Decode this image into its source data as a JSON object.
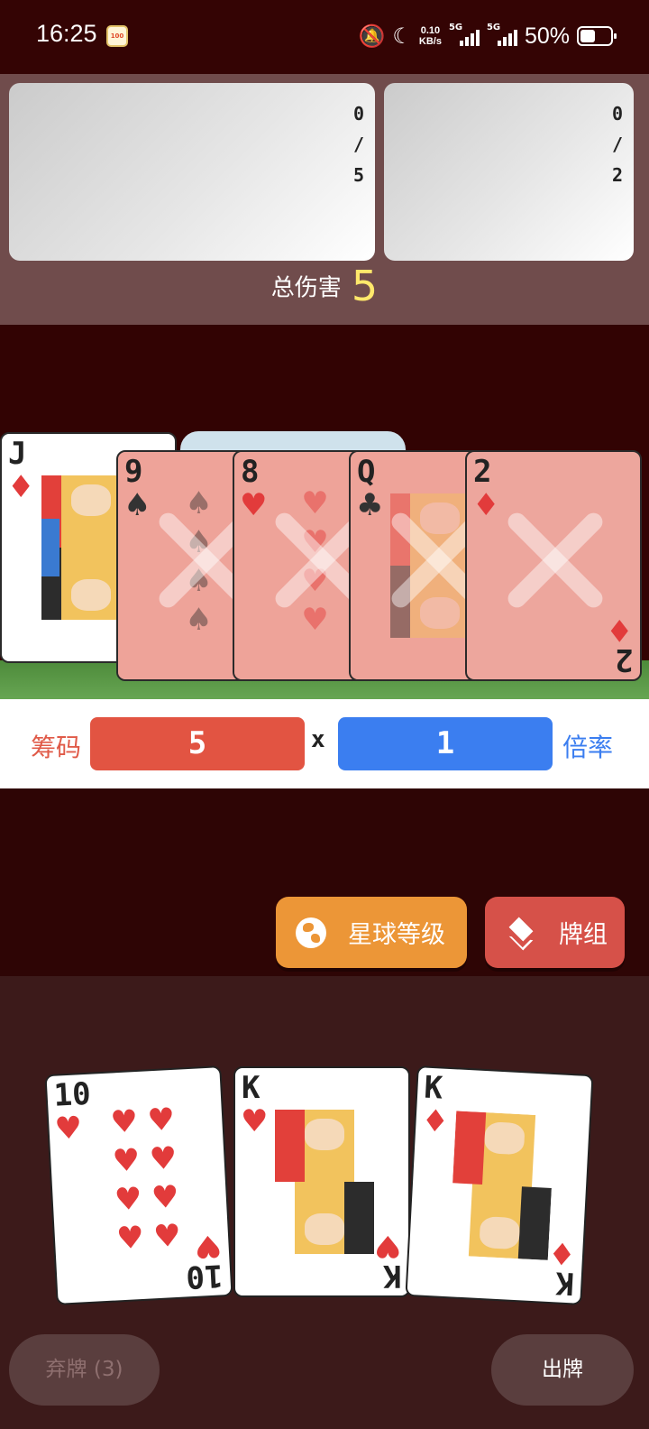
{
  "status_bar": {
    "time": "16:25",
    "app_badge": "100",
    "net_speed_value": "0.10",
    "net_speed_unit": "KB/s",
    "sim1_gen": "5G",
    "sim2_gen": "5G",
    "battery_percent": "50%",
    "battery_level": 0.5
  },
  "enemies": {
    "left": {
      "current": "0",
      "separator": "/",
      "max": "5"
    },
    "right": {
      "current": "0",
      "separator": "/",
      "max": "2"
    }
  },
  "total_damage": {
    "label": "总伤害",
    "value": "5"
  },
  "played_cards": [
    {
      "rank": "J",
      "suit": "♦",
      "color": "#e23b3b",
      "crossed": false
    },
    {
      "rank": "9",
      "suit": "♠",
      "color": "#333333",
      "crossed": true
    },
    {
      "rank": "8",
      "suit": "♥",
      "color": "#e23b3b",
      "crossed": true
    },
    {
      "rank": "Q",
      "suit": "♣",
      "color": "#333333",
      "crossed": true
    },
    {
      "rank": "2",
      "suit": "♦",
      "color": "#e23b3b",
      "crossed": true
    }
  ],
  "score": {
    "chips_label": "筹码",
    "chips_value": "5",
    "times_symbol": "x",
    "mult_value": "1",
    "mult_label": "倍率"
  },
  "actions": {
    "planet_label": "星球等级",
    "deck_label": "牌组"
  },
  "hand_cards": [
    {
      "rank": "10",
      "suit": "♥",
      "color": "#e23b3b"
    },
    {
      "rank": "K",
      "suit": "♥",
      "color": "#e23b3b"
    },
    {
      "rank": "K",
      "suit": "♦",
      "color": "#e23b3b"
    }
  ],
  "bottom_buttons": {
    "discard_label": "弃牌 (3)",
    "play_label": "出牌"
  },
  "colors": {
    "chips": "#e25442",
    "mult": "#3b7ef0",
    "planet_button": "#ec9637",
    "deck_button": "#d65149",
    "damage_value": "#ffe86b"
  }
}
